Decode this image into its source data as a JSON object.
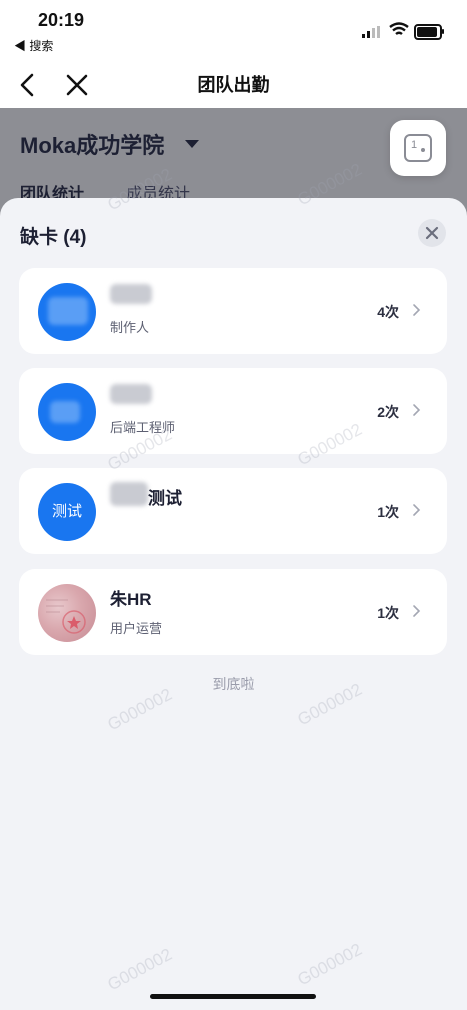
{
  "status_bar": {
    "time": "20:19",
    "back_app": "◀ 搜索"
  },
  "nav": {
    "title": "团队出勤"
  },
  "page": {
    "org_name": "Moka成功学院",
    "tabs": [
      "团队统计",
      "成员统计"
    ],
    "float_button_number": "1"
  },
  "sheet": {
    "title": "缺卡 (4)",
    "items": [
      {
        "avatar_text": "",
        "name": "",
        "role": "制作人",
        "count": "4次"
      },
      {
        "avatar_text": "",
        "name": "",
        "role": "后端工程师",
        "count": "2次"
      },
      {
        "avatar_text": "测试",
        "name": "测试",
        "role": "",
        "count": "1次"
      },
      {
        "avatar_text": "",
        "name": "朱HR",
        "role": "用户运营",
        "count": "1次"
      }
    ],
    "end_text": "到底啦"
  },
  "watermark": "G000002",
  "colors": {
    "accent": "#1976f0",
    "text": "#1d2033",
    "sheet_bg": "#f2f3f7"
  }
}
